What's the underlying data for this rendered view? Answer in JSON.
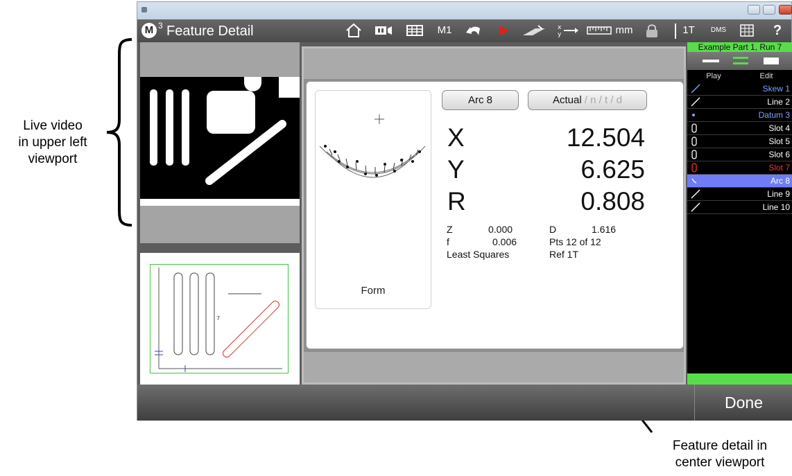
{
  "annotations": {
    "left_line1": "Live video",
    "left_line2": "in upper left",
    "left_line3": "viewport",
    "right_line1": "Feature detail in",
    "right_line2": "center viewport"
  },
  "toolbar": {
    "title": "Feature Detail",
    "logo_letter": "M",
    "logo_sup": "3",
    "m1_label": "M1",
    "units_label": "mm",
    "ref_label": "1T",
    "angle_label": "DMS",
    "help_label": "?",
    "icons": [
      "home-icon",
      "video-icon",
      "grid-icon",
      "undo-icon",
      "play-icon",
      "probe-icon",
      "xy-swap-icon",
      "ruler-icon",
      "lock-icon",
      "table-icon",
      "help-icon"
    ]
  },
  "center": {
    "feature_name": "Arc 8",
    "mode_label": "Actual",
    "mode_suffix": " / n / t / d",
    "x_label": "X",
    "x_value": "12.504",
    "y_label": "Y",
    "y_value": "6.625",
    "r_label": "R",
    "r_value": "0.808",
    "z_label": "Z",
    "z_value": "0.000",
    "f_label": "f",
    "f_value": "0.006",
    "method": "Least Squares",
    "d_label": "D",
    "d_value": "1.616",
    "points": "Pts 12 of 12",
    "ref": "Ref 1T",
    "form_label": "Form"
  },
  "run": {
    "title": "Example Part 1, Run 7",
    "play_tab": "Play",
    "edit_tab": "Edit"
  },
  "features": [
    {
      "name": "Skew 1",
      "icon": "line-icon",
      "color": "#7ea3ff",
      "bg": "#000000"
    },
    {
      "name": "Line 2",
      "icon": "line-icon",
      "color": "#ffffff",
      "bg": "#000000"
    },
    {
      "name": "Datum 3",
      "icon": "point-icon",
      "color": "#7ea3ff",
      "bg": "#000000"
    },
    {
      "name": "Slot 4",
      "icon": "slot-icon",
      "color": "#ffffff",
      "bg": "#000000"
    },
    {
      "name": "Slot 5",
      "icon": "slot-icon",
      "color": "#ffffff",
      "bg": "#000000"
    },
    {
      "name": "Slot 6",
      "icon": "slot-icon",
      "color": "#ffffff",
      "bg": "#000000"
    },
    {
      "name": "Slot 7",
      "icon": "slot-icon",
      "color": "#ff2a2a",
      "bg": "#000000"
    },
    {
      "name": "Arc 8",
      "icon": "arc-icon",
      "color": "#ffffff",
      "bg": "#6e7df5"
    },
    {
      "name": "Line 9",
      "icon": "line-icon",
      "color": "#ffffff",
      "bg": "#000000"
    },
    {
      "name": "Line 10",
      "icon": "line-icon",
      "color": "#ffffff",
      "bg": "#000000"
    }
  ],
  "done_label": "Done",
  "colors": {
    "accent_green": "#59dc4a",
    "selected_row": "#6e7df5",
    "error_red": "#ff2a2a",
    "datum_blue": "#7ea3ff"
  }
}
